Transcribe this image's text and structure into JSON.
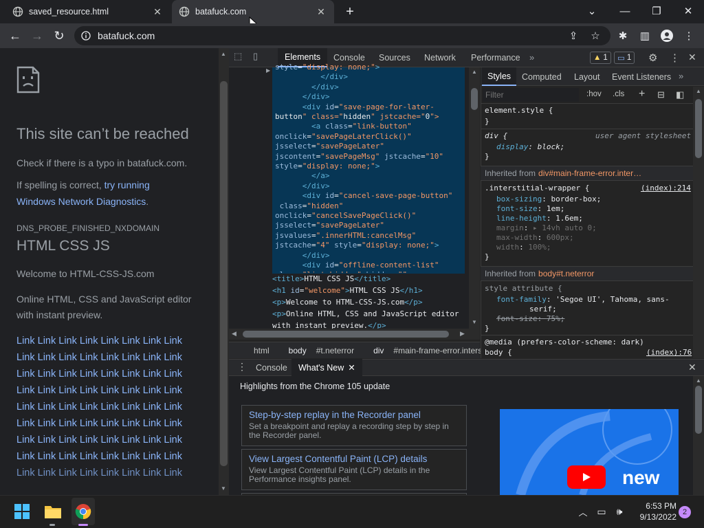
{
  "tabs": [
    {
      "title": "saved_resource.html",
      "active": false
    },
    {
      "title": "batafuck.com",
      "active": true
    }
  ],
  "toolbar": {
    "url": "batafuck.com"
  },
  "page": {
    "heading": "This site can’t be reached",
    "typo_text": "Check if there is a typo in batafuck.com.",
    "spelling_prefix": "If spelling is correct, ",
    "diag_link_1": "try running",
    "diag_link_2": "Windows Network Diagnostics",
    "diag_suffix": ".",
    "error_code": "DNS_PROBE_FINISHED_NXDOMAIN",
    "site_title": "HTML CSS JS",
    "welcome": "Welcome to HTML-CSS-JS.com",
    "desc_line1": "Online HTML, CSS and JavaScript editor",
    "desc_line2": "with instant preview.",
    "link_rows": [
      "Link Link Link Link Link Link Link Link",
      "Link Link Link Link Link Link Link Link",
      "Link Link Link Link Link Link Link Link",
      "Link Link Link Link Link Link Link Link",
      "Link Link Link Link Link Link Link Link",
      "Link Link Link Link Link Link Link Link",
      "Link Link Link Link Link Link Link Link",
      "Link Link Link Link Link Link Link Link",
      "Link Link Link Link Link Link Link Link"
    ]
  },
  "devtools": {
    "tabs": [
      "Elements",
      "Console",
      "Sources",
      "Network",
      "Performance"
    ],
    "active_tab": "Elements",
    "warn_count": "1",
    "msg_count": "1",
    "code_lines": [
      "style=\"display: none;\">",
      "          </div>",
      "        </div>",
      "      </div>",
      "      <div id=\"save-page-for-later-",
      "button\" class=\"hidden\" jstcache=\"0\">",
      "        <a class=\"link-button\"",
      "onclick=\"savePageLaterClick()\"",
      "jsselect=\"savePageLater\"",
      "jscontent=\"savePageMsg\" jstcache=\"10\"",
      "style=\"display: none;\">",
      "        </a>",
      "      </div>",
      "      <div id=\"cancel-save-page-button\"",
      " class=\"hidden\"",
      "onclick=\"cancelSavePageClick()\"",
      "jsselect=\"savePageLater\"",
      "jsvalues=\".innerHTML:cancelMsg\"",
      "jstcache=\"4\" style=\"display: none;\">",
      "      </div>",
      "      <div id=\"offline-content-list\"",
      "class=\"list-hidden\" hidden=\"\""
    ],
    "html_lines": [
      "<title>HTML CSS JS</title>",
      "<h1 id=\"welcome\">HTML CSS JS</h1>",
      "<p>Welcome to HTML-CSS-JS.com</p>",
      "<p>Online HTML, CSS and JavaScript editor",
      "with instant preview.</p>"
    ],
    "breadcrumbs": [
      "html",
      "body#t.neterror",
      "div#main-frame-error.interstiti"
    ],
    "styles_tabs": [
      "Styles",
      "Computed",
      "Layout",
      "Event Listeners"
    ],
    "filter_placeholder": "Filter",
    "hov": ":hov",
    "cls": ".cls",
    "element_style": "element.style {",
    "close_brace": "}",
    "div_rule": "div {",
    "ua_stylesheet": "user agent stylesheet",
    "div_prop": "display",
    "div_val": "block;",
    "inherited_1_label": "Inherited from",
    "inherited_1_sel": "div#main-frame-error.inter…",
    "wrapper_rule": ".interstitial-wrapper {",
    "wrapper_src": "(index):214",
    "wrapper_props": [
      {
        "p": "box-sizing",
        "v": "border-box;",
        "muted": false
      },
      {
        "p": "font-size",
        "v": "1em;",
        "muted": false
      },
      {
        "p": "line-height",
        "v": "1.6em;",
        "muted": false
      },
      {
        "p": "margin",
        "v": "▸ 14vh auto 0;",
        "muted": true
      },
      {
        "p": "max-width",
        "v": "600px;",
        "muted": true
      },
      {
        "p": "width",
        "v": "100%;",
        "muted": true
      }
    ],
    "inherited_2_label": "Inherited from",
    "inherited_2_sel": "body#t.neterror",
    "style_attr": "style attribute {",
    "ff_prop": "font-family",
    "ff_val": "'Segoe UI', Tahoma, sans-",
    "ff_val2": "serif;",
    "fs_prop": "font-size",
    "fs_val": "75%;",
    "media": "@media (prefers-color-scheme: dark)",
    "body_rule": "body {",
    "body_src": "(index):76"
  },
  "drawer": {
    "tabs": [
      "Console",
      "What's New"
    ],
    "highlights": "Highlights from the Chrome 105 update",
    "cards": [
      {
        "title": "Step-by-step replay in the Recorder panel",
        "desc": "Set a breakpoint and replay a recording step by step in the Recorder panel."
      },
      {
        "title": "View Largest Contentful Paint (LCP) details",
        "desc": "View Largest Contentful Paint (LCP) details in the Performance insights panel."
      }
    ],
    "video_text": "new"
  },
  "taskbar": {
    "time": "6:53 PM",
    "date": "9/13/2022",
    "notifications": "2"
  },
  "colors": {
    "accent": "#8ab4f8",
    "selection": "#073655",
    "brand_blue": "#1a73e8"
  }
}
